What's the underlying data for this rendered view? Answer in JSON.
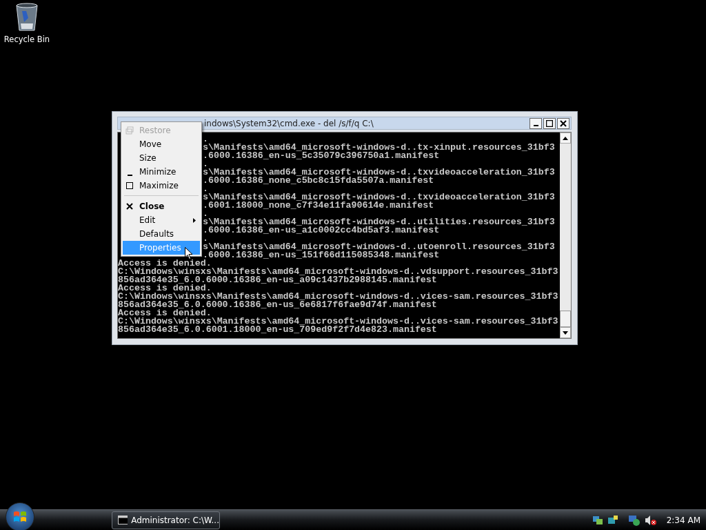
{
  "desktop": {
    "icons": [
      {
        "label": "Recycle Bin"
      }
    ]
  },
  "window": {
    "title": "indows\\System32\\cmd.exe - del  /s/f/q C:\\"
  },
  "console": {
    "lines": [
      {
        "kind": "partial",
        "text": "."
      },
      {
        "kind": "partial",
        "text": "s\\Manifests\\amd64_microsoft-windows-d..tx-xinput.resources_31bf3"
      },
      {
        "kind": "partial",
        "text": ".6000.16386_en-us_5c35079c396750a1.manifest"
      },
      {
        "kind": "partial",
        "text": "."
      },
      {
        "kind": "partial",
        "text": "s\\Manifests\\amd64_microsoft-windows-d..txvideoacceleration_31bf3"
      },
      {
        "kind": "partial",
        "text": ".6000.16386_none_c5bc8c15fda5507a.manifest"
      },
      {
        "kind": "partial",
        "text": "."
      },
      {
        "kind": "partial",
        "text": "s\\Manifests\\amd64_microsoft-windows-d..txvideoacceleration_31bf3"
      },
      {
        "kind": "partial",
        "text": ".6001.18000_none_c7f34e11fa90614e.manifest"
      },
      {
        "kind": "partial",
        "text": "."
      },
      {
        "kind": "partial",
        "text": "s\\Manifests\\amd64_microsoft-windows-d..utilities.resources_31bf3"
      },
      {
        "kind": "partial",
        "text": ".6000.16386_en-us_a1c0002cc4bd5af3.manifest"
      },
      {
        "kind": "partial",
        "text": "."
      },
      {
        "kind": "partial",
        "text": "s\\Manifests\\amd64_microsoft-windows-d..utoenroll.resources_31bf3"
      },
      {
        "kind": "partial",
        "text": ".6000.16386_en-us_151f66d115085348.manifest"
      },
      {
        "kind": "full",
        "text": "Access is denied."
      },
      {
        "kind": "full",
        "text": "C:\\Windows\\winsxs\\Manifests\\amd64_microsoft-windows-d..vdsupport.resources_31bf3"
      },
      {
        "kind": "full",
        "text": "856ad364e35_6.0.6000.16386_en-us_a09c1437b2988145.manifest"
      },
      {
        "kind": "full",
        "text": "Access is denied."
      },
      {
        "kind": "full",
        "text": "C:\\Windows\\winsxs\\Manifests\\amd64_microsoft-windows-d..vices-sam.resources_31bf3"
      },
      {
        "kind": "full",
        "text": "856ad364e35_6.0.6000.16386_en-us_6e6817f6fae9d74f.manifest"
      },
      {
        "kind": "full",
        "text": "Access is denied."
      },
      {
        "kind": "full",
        "text": "C:\\Windows\\winsxs\\Manifests\\amd64_microsoft-windows-d..vices-sam.resources_31bf3"
      },
      {
        "kind": "full",
        "text": "856ad364e35_6.0.6001.18000_en-us_709ed9f2f7d4e823.manifest"
      }
    ]
  },
  "system_menu": {
    "items": [
      {
        "kind": "restore",
        "label": "Restore",
        "disabled": true,
        "selected": false
      },
      {
        "kind": "plain",
        "label": "Move",
        "disabled": false,
        "selected": false
      },
      {
        "kind": "plain",
        "label": "Size",
        "disabled": false,
        "selected": false
      },
      {
        "kind": "minimize",
        "label": "Minimize",
        "disabled": false,
        "selected": false
      },
      {
        "kind": "maximize",
        "label": "Maximize",
        "disabled": false,
        "selected": false
      },
      {
        "kind": "separator"
      },
      {
        "kind": "close",
        "label": "Close",
        "disabled": false,
        "selected": false
      },
      {
        "kind": "submenu",
        "label": "Edit",
        "disabled": false,
        "selected": false
      },
      {
        "kind": "plain",
        "label": "Defaults",
        "disabled": false,
        "selected": false
      },
      {
        "kind": "plain",
        "label": "Properties",
        "disabled": false,
        "selected": true
      }
    ]
  },
  "taskbar": {
    "tasks": [
      {
        "label": "Administrator: C:\\W..."
      }
    ],
    "clock": "2:34 AM"
  }
}
